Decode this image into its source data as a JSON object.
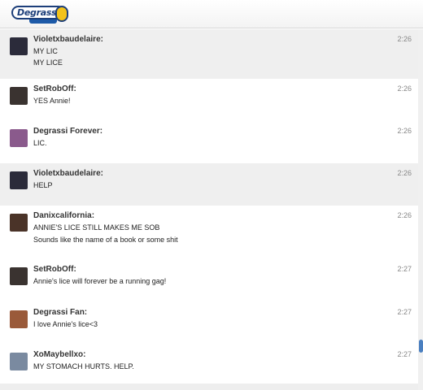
{
  "header": {
    "logo_text": "Degrassi",
    "logo_sub": "WIKI"
  },
  "messages": [
    {
      "author": "Violetxbaudelaire:",
      "time": "2:26",
      "lines": [
        "MY LIC",
        "MY LICE"
      ],
      "avatar_color": "#2b2b3a"
    },
    {
      "author": "SetRobOff:",
      "time": "2:26",
      "lines": [
        "YES Annie!"
      ],
      "avatar_color": "#3a3330"
    },
    {
      "author": "Degrassi Forever:",
      "time": "2:26",
      "lines": [
        "LIC."
      ],
      "avatar_color": "#8a5a8c"
    },
    {
      "author": "Violetxbaudelaire:",
      "time": "2:26",
      "lines": [
        "HELP"
      ],
      "avatar_color": "#2b2b3a"
    },
    {
      "author": "Danixcalifornia:",
      "time": "2:26",
      "lines": [
        "ANNIE'S LICE STILL MAKES ME SOB",
        "Sounds like the name of a book or some shit"
      ],
      "avatar_color": "#4a3328"
    },
    {
      "author": "SetRobOff:",
      "time": "2:27",
      "lines": [
        "Annie's lice will forever be a running gag!"
      ],
      "avatar_color": "#3a3330"
    },
    {
      "author": "Degrassi Fan:",
      "time": "2:27",
      "lines": [
        "I love Annie's lice<3"
      ],
      "avatar_color": "#9a5a3a"
    },
    {
      "author": "XoMaybellxo:",
      "time": "2:27",
      "lines": [
        "MY STOMACH HURTS. HELP."
      ],
      "avatar_color": "#7a8aa0"
    }
  ]
}
